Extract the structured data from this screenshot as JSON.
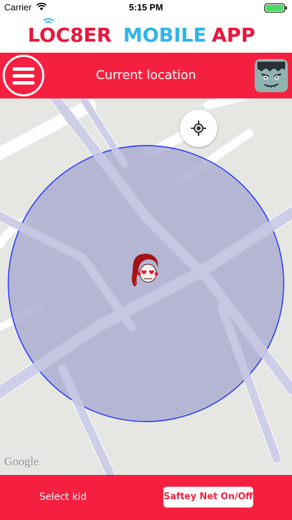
{
  "status_bar": {
    "carrier": "Carrier",
    "time": "5:15 PM"
  },
  "logo": {
    "part1": "LOC8ER",
    "part2": "MOBILE",
    "part3": "APP"
  },
  "header": {
    "title": "Current location",
    "menu_icon": "hamburger-menu-icon",
    "avatar_icon": "frankenstein-avatar"
  },
  "map": {
    "attribution": "Google",
    "locate_icon": "crosshair-icon",
    "marker_icon": "sugar-skull-girl-icon"
  },
  "footer": {
    "select_kid": "Select kid",
    "safety_net": "Saftey Net On/Off"
  },
  "colors": {
    "brand_red": "#f5203f",
    "logo_red": "#e8173c",
    "logo_blue": "#2fb5e8",
    "safety_circle_fill": "#a9abd0",
    "safety_circle_stroke": "#1a2cff",
    "map_bg": "#e6e6e3"
  }
}
